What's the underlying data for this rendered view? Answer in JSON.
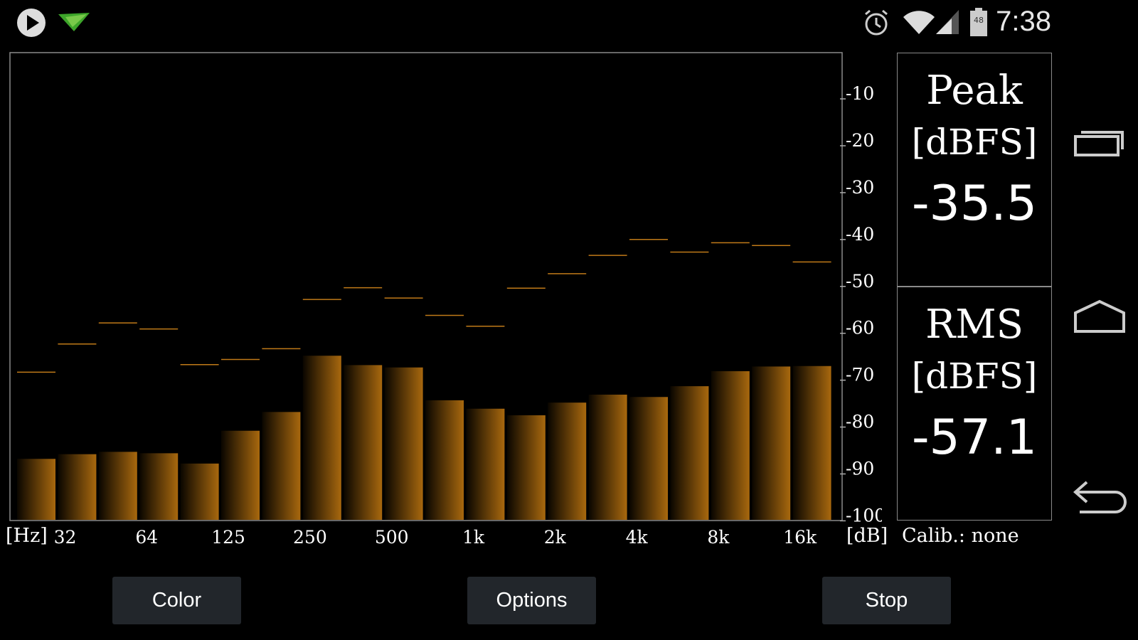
{
  "status_bar": {
    "time": "7:38",
    "battery_level": "48",
    "icons": [
      "play-icon",
      "paper-plane-icon",
      "alarm-icon",
      "wifi-icon",
      "signal-icon",
      "battery-icon"
    ]
  },
  "chart_data": {
    "type": "bar",
    "categories": [
      "32",
      "",
      "64",
      "",
      "125",
      "",
      "250",
      "",
      "500",
      "",
      "1k",
      "",
      "2k",
      "",
      "4k",
      "",
      "8k",
      "",
      "16k",
      ""
    ],
    "x_tick_labels": [
      "32",
      "64",
      "125",
      "250",
      "500",
      "1k",
      "2k",
      "4k",
      "8k",
      "16k"
    ],
    "series": [
      {
        "values": [
          -88,
          -87,
          -86.5,
          -86.8,
          -89,
          -82,
          -78,
          -66,
          -68,
          -68.5,
          -75.5,
          -77.3,
          -78.7,
          -76,
          -74.3,
          -74.8,
          -72.5,
          -69.3,
          -68.3,
          -68.2
        ]
      },
      {
        "values": [
          -69.5,
          -63.5,
          -59,
          -60.3,
          -67.9,
          -66.8,
          -64.5,
          -54,
          -51.5,
          -53.7,
          -57.4,
          -59.7,
          -51.6,
          -48.5,
          -44.6,
          -41.2,
          -43.9,
          -41.9,
          -42.5,
          -46
        ]
      }
    ],
    "xlabel": "[Hz]",
    "ylabel": "[dB]",
    "yticks": [
      "-10",
      "-20",
      "-30",
      "-40",
      "-50",
      "-60",
      "-70",
      "-80",
      "-90",
      "-100"
    ],
    "ylim": [
      -101,
      -1.5
    ]
  },
  "peak": {
    "title": "Peak",
    "unit": "[dBFS]",
    "value": "-35.5"
  },
  "rms": {
    "title": "RMS",
    "unit": "[dBFS]",
    "value": "-57.1"
  },
  "calibration": "Calib.: none",
  "buttons": {
    "color": "Color",
    "options": "Options",
    "stop": "Stop"
  },
  "colors": {
    "bar_top": "#a8680e",
    "bar_bottom": "#0a0600",
    "peak_marker": "#c07a18",
    "frame": "#8a8a8a"
  },
  "nav_icons": [
    "recent-apps-icon",
    "home-icon",
    "back-icon"
  ]
}
